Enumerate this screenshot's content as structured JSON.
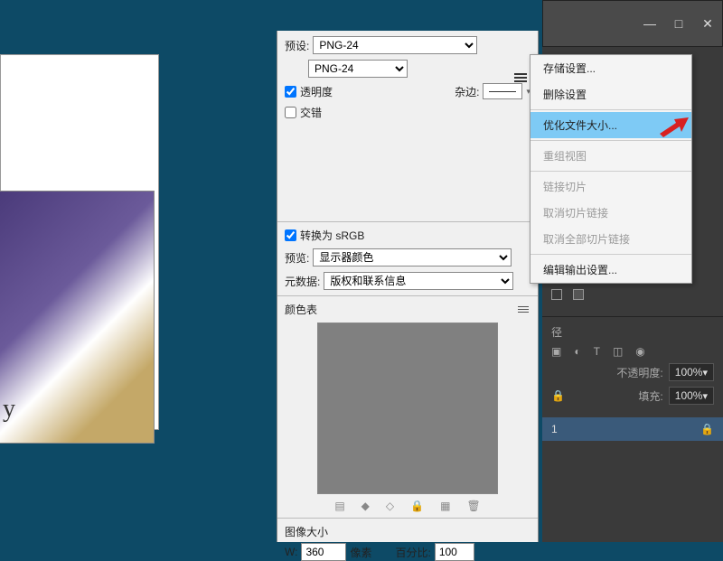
{
  "canvas": {
    "y_label": "y"
  },
  "options": {
    "preset_label": "预设:",
    "preset_value": "PNG-24",
    "format_value": "PNG-24",
    "transparency_label": "透明度",
    "matte_label": "杂边:",
    "interlace_label": "交错",
    "convert_srgb_label": "转换为 sRGB",
    "preview_label": "预览:",
    "preview_value": "显示器颜色",
    "metadata_label": "元数据:",
    "metadata_value": "版权和联系信息",
    "color_table_label": "颜色表",
    "image_size_label": "图像大小",
    "width_label": "W:",
    "width_value": "360",
    "width_unit": "像素",
    "percent_label": "百分比:",
    "percent_value": "100"
  },
  "menu": {
    "items": [
      {
        "label": "存储设置...",
        "sel": false,
        "dis": false
      },
      {
        "label": "删除设置",
        "sel": false,
        "dis": false
      },
      {
        "sep": true
      },
      {
        "label": "优化文件大小...",
        "sel": true,
        "dis": false
      },
      {
        "sep": true
      },
      {
        "label": "重组视图",
        "sel": false,
        "dis": true
      },
      {
        "sep": true
      },
      {
        "label": "链接切片",
        "sel": false,
        "dis": true
      },
      {
        "label": "取消切片链接",
        "sel": false,
        "dis": true
      },
      {
        "label": "取消全部切片链接",
        "sel": false,
        "dis": true
      },
      {
        "sep": true
      },
      {
        "label": "编辑输出设置...",
        "sel": false,
        "dis": false
      }
    ]
  },
  "layers": {
    "opacity_label": "不透明度:",
    "opacity_val": "100%",
    "fill_label": "填充:",
    "fill_val": "100%",
    "item": "1",
    "path_tab": "径"
  },
  "titlebar": {
    "min": "—",
    "max": "□",
    "close": "✕"
  }
}
